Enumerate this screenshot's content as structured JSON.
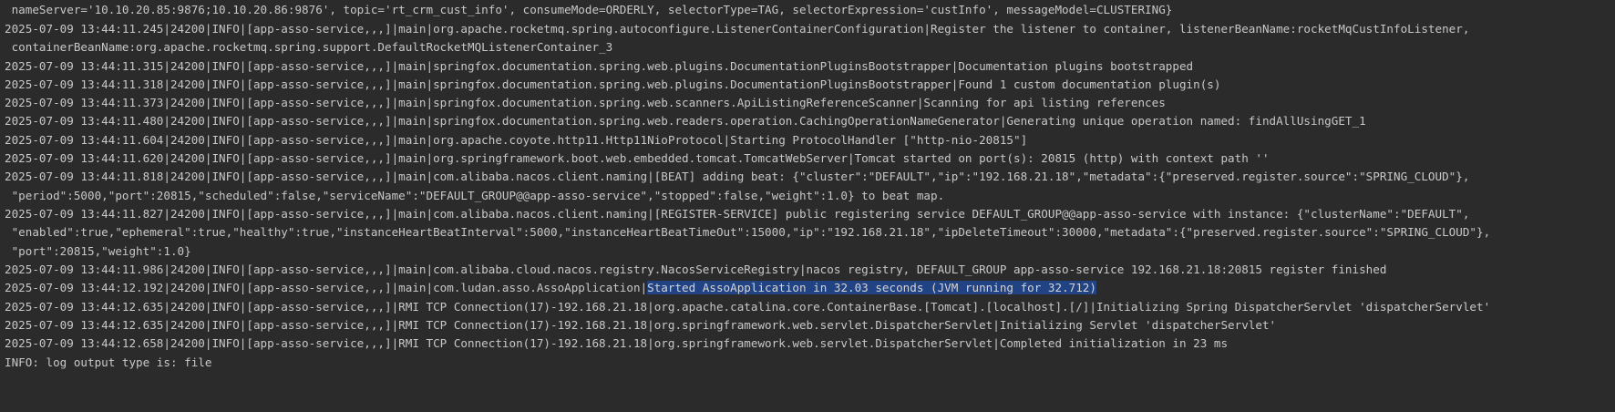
{
  "log_lines": [
    {
      "text": " nameServer='10.10.20.85:9876;10.10.20.86:9876', topic='rt_crm_cust_info', consumeMode=ORDERLY, selectorType=TAG, selectorExpression='custInfo', messageModel=CLUSTERING}"
    },
    {
      "text": "2025-07-09 13:44:11.245|24200|INFO|[app-asso-service,,,]|main|org.apache.rocketmq.spring.autoconfigure.ListenerContainerConfiguration|Register the listener to container, listenerBeanName:rocketMqCustInfoListener,"
    },
    {
      "text": " containerBeanName:org.apache.rocketmq.spring.support.DefaultRocketMQListenerContainer_3"
    },
    {
      "text": "2025-07-09 13:44:11.315|24200|INFO|[app-asso-service,,,]|main|springfox.documentation.spring.web.plugins.DocumentationPluginsBootstrapper|Documentation plugins bootstrapped"
    },
    {
      "text": "2025-07-09 13:44:11.318|24200|INFO|[app-asso-service,,,]|main|springfox.documentation.spring.web.plugins.DocumentationPluginsBootstrapper|Found 1 custom documentation plugin(s)"
    },
    {
      "text": "2025-07-09 13:44:11.373|24200|INFO|[app-asso-service,,,]|main|springfox.documentation.spring.web.scanners.ApiListingReferenceScanner|Scanning for api listing references"
    },
    {
      "text": "2025-07-09 13:44:11.480|24200|INFO|[app-asso-service,,,]|main|springfox.documentation.spring.web.readers.operation.CachingOperationNameGenerator|Generating unique operation named: findAllUsingGET_1"
    },
    {
      "text": "2025-07-09 13:44:11.604|24200|INFO|[app-asso-service,,,]|main|org.apache.coyote.http11.Http11NioProtocol|Starting ProtocolHandler [\"http-nio-20815\"]"
    },
    {
      "text": "2025-07-09 13:44:11.620|24200|INFO|[app-asso-service,,,]|main|org.springframework.boot.web.embedded.tomcat.TomcatWebServer|Tomcat started on port(s): 20815 (http) with context path ''"
    },
    {
      "text": "2025-07-09 13:44:11.818|24200|INFO|[app-asso-service,,,]|main|com.alibaba.nacos.client.naming|[BEAT] adding beat: {\"cluster\":\"DEFAULT\",\"ip\":\"192.168.21.18\",\"metadata\":{\"preserved.register.source\":\"SPRING_CLOUD\"},"
    },
    {
      "text": " \"period\":5000,\"port\":20815,\"scheduled\":false,\"serviceName\":\"DEFAULT_GROUP@@app-asso-service\",\"stopped\":false,\"weight\":1.0} to beat map."
    },
    {
      "text": "2025-07-09 13:44:11.827|24200|INFO|[app-asso-service,,,]|main|com.alibaba.nacos.client.naming|[REGISTER-SERVICE] public registering service DEFAULT_GROUP@@app-asso-service with instance: {\"clusterName\":\"DEFAULT\","
    },
    {
      "text": " \"enabled\":true,\"ephemeral\":true,\"healthy\":true,\"instanceHeartBeatInterval\":5000,\"instanceHeartBeatTimeOut\":15000,\"ip\":\"192.168.21.18\",\"ipDeleteTimeout\":30000,\"metadata\":{\"preserved.register.source\":\"SPRING_CLOUD\"},"
    },
    {
      "text": " \"port\":20815,\"weight\":1.0}"
    },
    {
      "text": "2025-07-09 13:44:11.986|24200|INFO|[app-asso-service,,,]|main|com.alibaba.cloud.nacos.registry.NacosServiceRegistry|nacos registry, DEFAULT_GROUP app-asso-service 192.168.21.18:20815 register finished"
    },
    {
      "text": "2025-07-09 13:44:12.192|24200|INFO|[app-asso-service,,,]|main|com.ludan.asso.AssoApplication|",
      "highlight": "Started AssoApplication in 32.03 seconds (JVM running for 32.712)"
    },
    {
      "text": "2025-07-09 13:44:12.635|24200|INFO|[app-asso-service,,,]|RMI TCP Connection(17)-192.168.21.18|org.apache.catalina.core.ContainerBase.[Tomcat].[localhost].[/]|Initializing Spring DispatcherServlet 'dispatcherServlet'"
    },
    {
      "text": "2025-07-09 13:44:12.635|24200|INFO|[app-asso-service,,,]|RMI TCP Connection(17)-192.168.21.18|org.springframework.web.servlet.DispatcherServlet|Initializing Servlet 'dispatcherServlet'"
    },
    {
      "text": "2025-07-09 13:44:12.658|24200|INFO|[app-asso-service,,,]|RMI TCP Connection(17)-192.168.21.18|org.springframework.web.servlet.DispatcherServlet|Completed initialization in 23 ms"
    },
    {
      "text": "INFO: log output type is: file"
    }
  ]
}
